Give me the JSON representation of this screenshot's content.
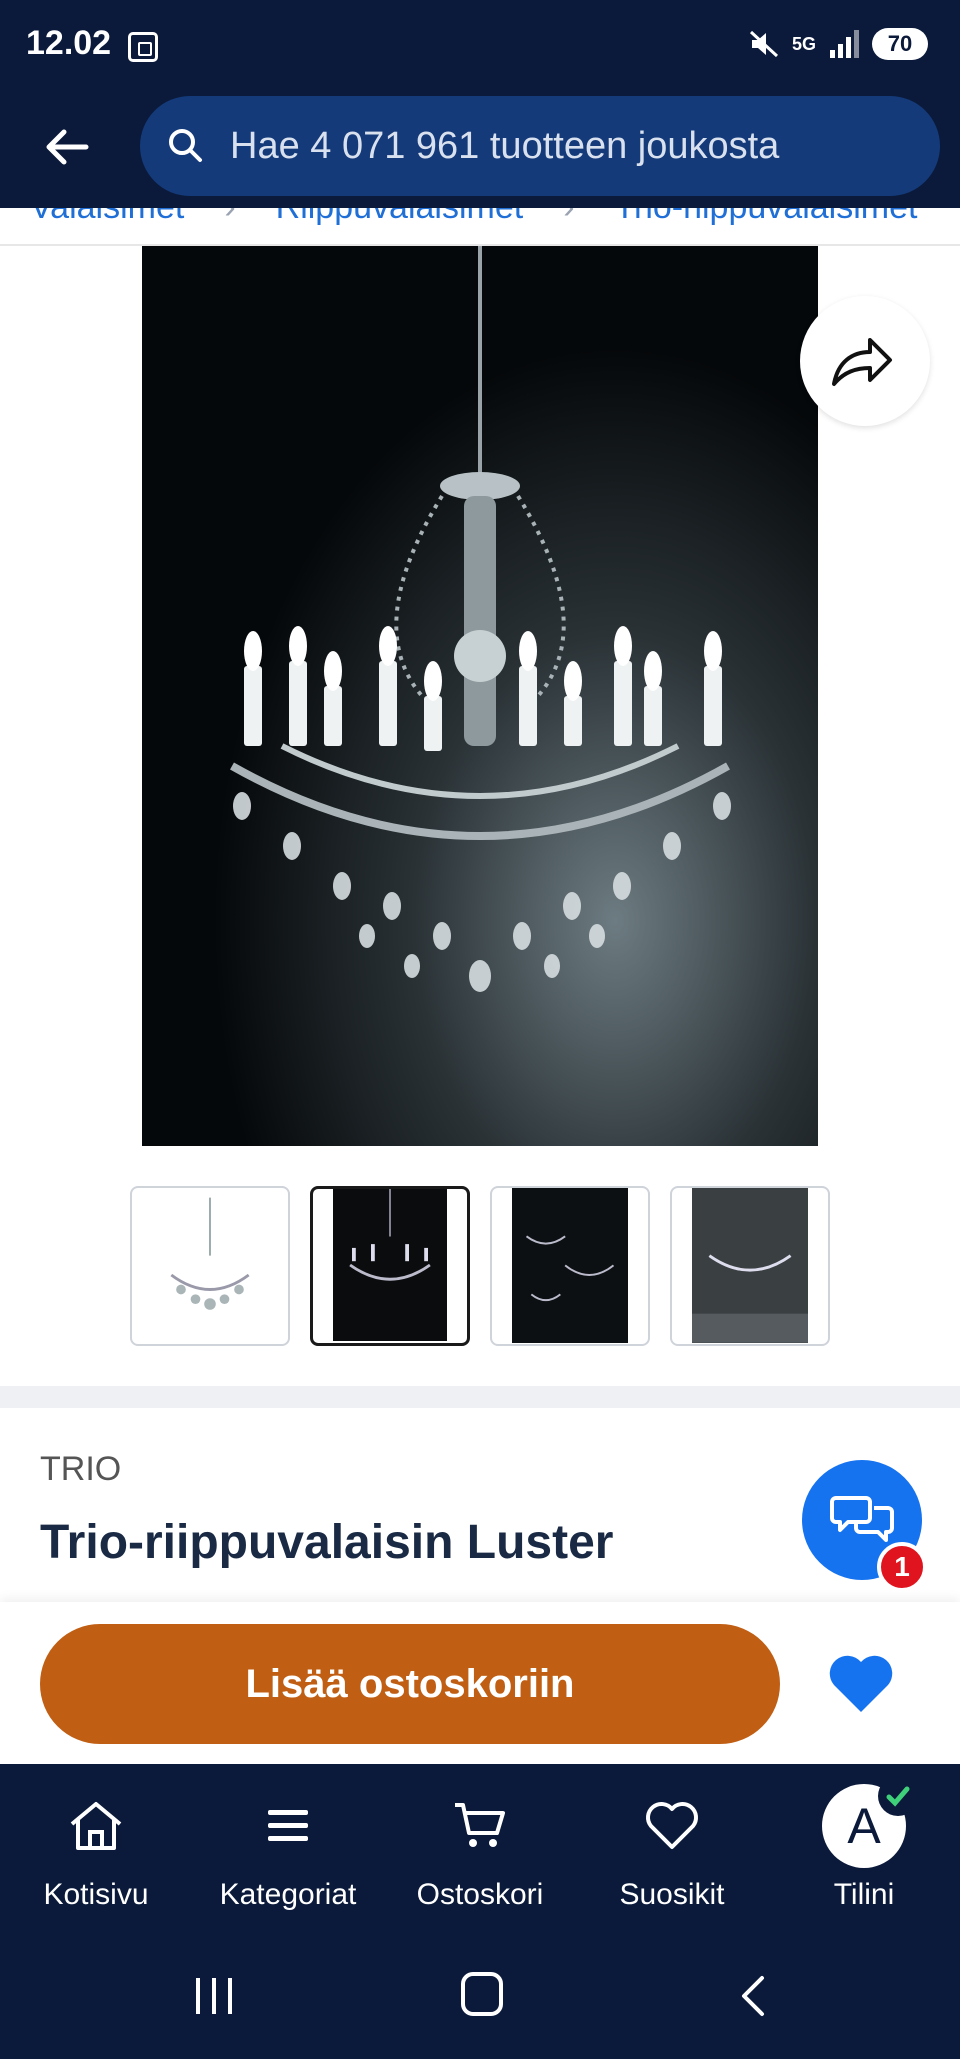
{
  "status_bar": {
    "time": "12.02",
    "network": "5G",
    "battery": "70"
  },
  "header": {
    "search_placeholder": "Hae 4 071 961 tuotteen joukosta"
  },
  "breadcrumb": {
    "items": [
      "Valaisimet",
      "Riippuvalaisimet",
      "Trio-riippuvalaisimet"
    ]
  },
  "product": {
    "brand": "TRIO",
    "title": "Trio-riippuvalaisin Luster"
  },
  "chat": {
    "badge_count": "1"
  },
  "actions": {
    "add_to_cart": "Lisää ostoskoriin"
  },
  "bottom_nav": {
    "items": [
      {
        "label": "Kotisivu",
        "icon": "home-icon"
      },
      {
        "label": "Kategoriat",
        "icon": "menu-icon"
      },
      {
        "label": "Ostoskori",
        "icon": "cart-icon"
      },
      {
        "label": "Suosikit",
        "icon": "heart-icon"
      },
      {
        "label": "Tilini",
        "icon": "avatar"
      }
    ],
    "avatar_letter": "A"
  },
  "colors": {
    "header_bg": "#0b1a3a",
    "search_bg": "#143a7a",
    "cta": "#c05f14",
    "accent_blue": "#1673f0",
    "badge_red": "#e0141e"
  }
}
